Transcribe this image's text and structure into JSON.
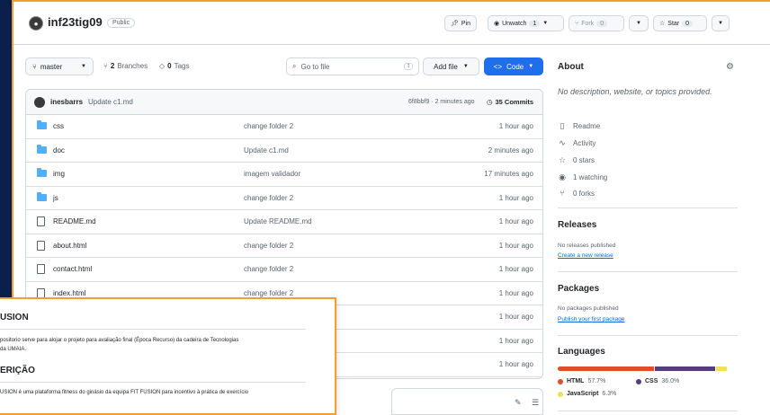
{
  "repo": {
    "name": "inf23tig09",
    "visibility": "Public"
  },
  "header_actions": {
    "pin": "Pin",
    "unwatch": "Unwatch",
    "unwatch_count": "1",
    "fork": "Fork",
    "fork_count": "0",
    "star": "Star",
    "star_count": "0"
  },
  "toolbar": {
    "branch": "master",
    "branches_count": "2",
    "branches_label": "Branches",
    "tags_count": "0",
    "tags_label": "Tags",
    "goto_placeholder": "Go to file",
    "goto_kbd": "t",
    "add_file": "Add file",
    "code": "Code"
  },
  "latest_commit": {
    "author": "inesbarrs",
    "message": "Update c1.md",
    "hash_time": "6f8bbf9 · 2 minutes ago",
    "commits": "35 Commits"
  },
  "files": [
    {
      "type": "folder",
      "name": "css",
      "message": "change folder 2",
      "time": "1 hour ago"
    },
    {
      "type": "folder",
      "name": "doc",
      "message": "Update c1.md",
      "time": "2 minutes ago"
    },
    {
      "type": "folder",
      "name": "img",
      "message": "imagem validador",
      "time": "17 minutes ago"
    },
    {
      "type": "folder",
      "name": "js",
      "message": "change folder 2",
      "time": "1 hour ago"
    },
    {
      "type": "file",
      "name": "README.md",
      "message": "Update README.md",
      "time": "1 hour ago"
    },
    {
      "type": "file",
      "name": "about.html",
      "message": "change folder 2",
      "time": "1 hour ago"
    },
    {
      "type": "file",
      "name": "contact.html",
      "message": "change folder 2",
      "time": "1 hour ago"
    },
    {
      "type": "file",
      "name": "index.html",
      "message": "change folder 2",
      "time": "1 hour ago"
    },
    {
      "type": "file",
      "name": "",
      "message": "",
      "time": "1 hour ago"
    },
    {
      "type": "file",
      "name": "",
      "message": "",
      "time": "1 hour ago"
    },
    {
      "type": "file",
      "name": "",
      "message": "",
      "time": "1 hour ago"
    }
  ],
  "overlay": {
    "heading1": "USION",
    "para1_line1": "positorio serve para alojar o projeto para avaliação final (Época Recurso) da cadeira de Tecnologias",
    "para1_line2": "da UMAIA.",
    "heading2": "ERIÇÃO",
    "para2_line1": "USION é uma plataforma fitness do ginásio da equipa FIT FUSION para incentivo à prática de exercício"
  },
  "readme_strip": {
    "edit_icon": "pencil-icon",
    "list_icon": "list-icon"
  },
  "about": {
    "title": "About",
    "description": "No description, website, or topics provided.",
    "readme": "Readme",
    "activity": "Activity",
    "stars": "0 stars",
    "watching": "1 watching",
    "forks": "0 forks"
  },
  "releases": {
    "title": "Releases",
    "none": "No releases published",
    "create": "Create a new release"
  },
  "packages": {
    "title": "Packages",
    "none": "No packages published",
    "publish": "Publish your first package"
  },
  "languages": {
    "title": "Languages",
    "items": [
      {
        "name": "HTML",
        "percent": "57.7%",
        "value": 57.7,
        "color": "#e34c26"
      },
      {
        "name": "CSS",
        "percent": "36.0%",
        "value": 36.0,
        "color": "#563d7c"
      },
      {
        "name": "JavaScript",
        "percent": "6.3%",
        "value": 6.3,
        "color": "#f1e05a"
      }
    ]
  }
}
